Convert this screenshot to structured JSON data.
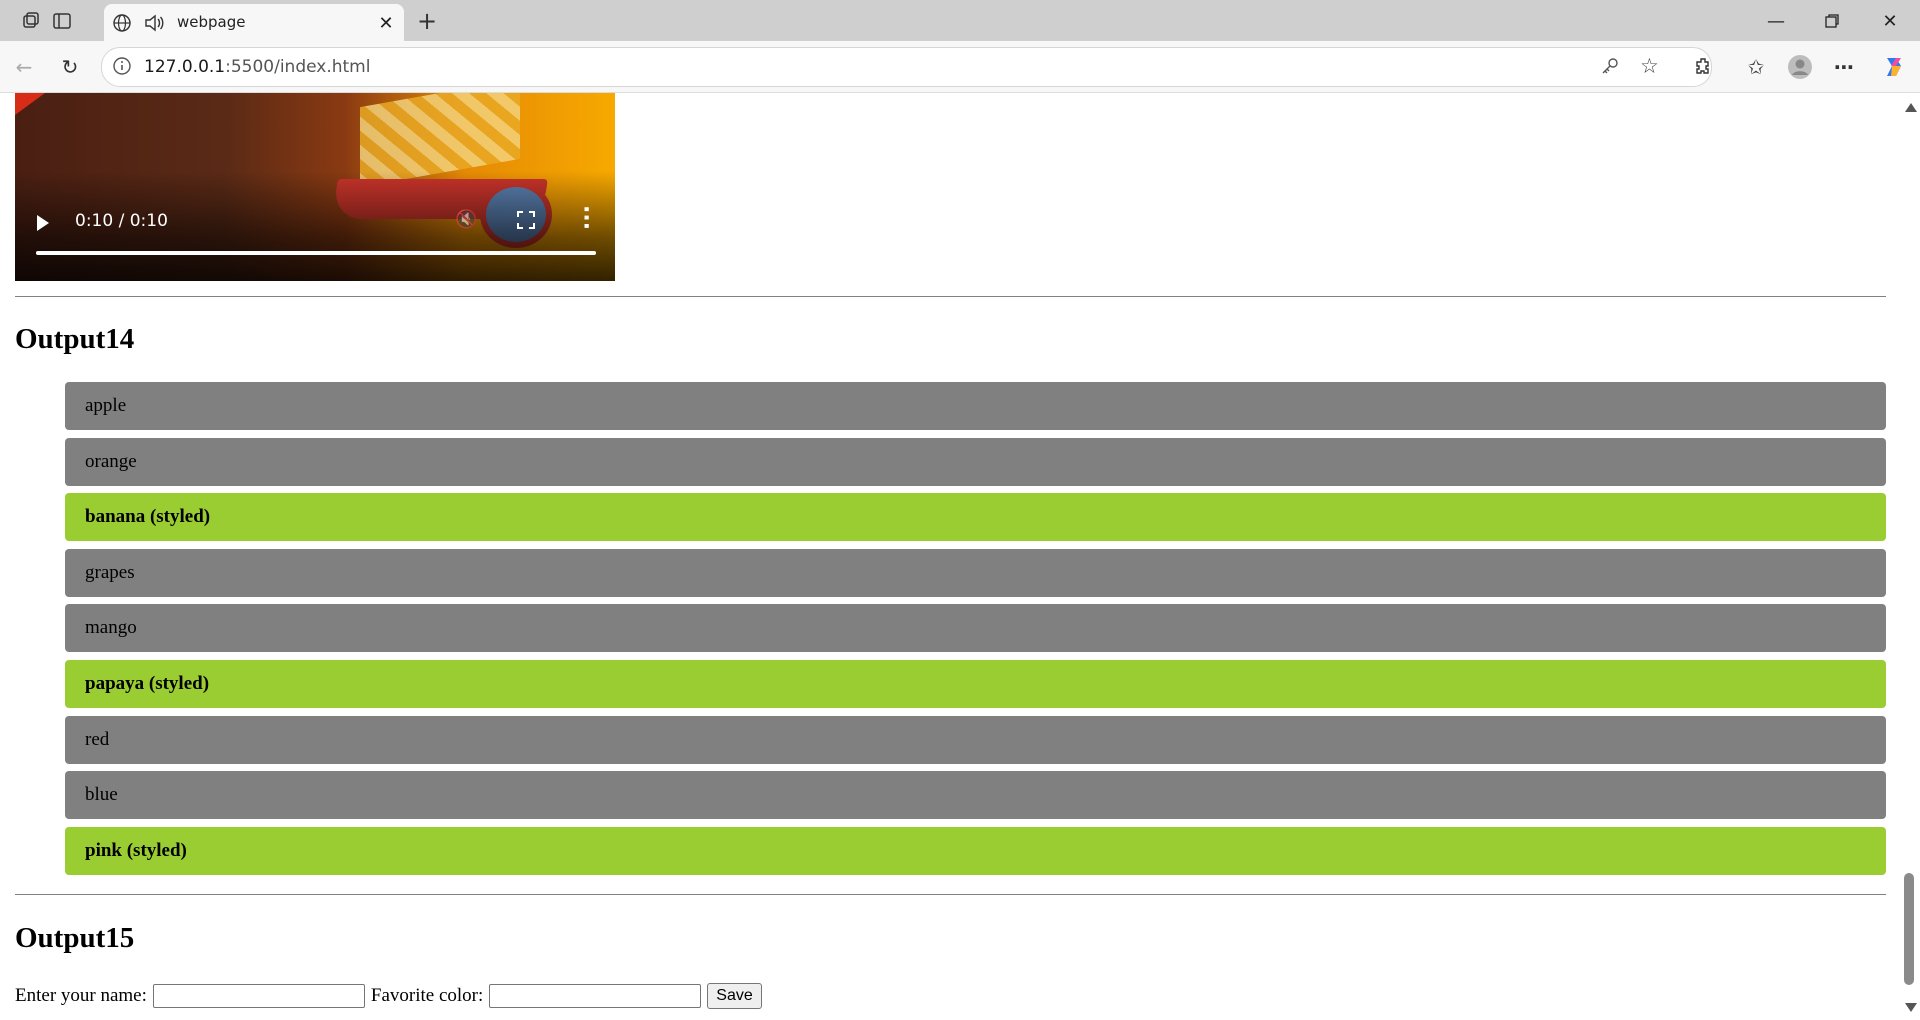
{
  "browser": {
    "tab_title": "webpage",
    "url_host": "127.0.0.1",
    "url_rest": ":5500/index.html"
  },
  "video": {
    "time": "0:10 / 0:10",
    "progress_fraction": 1.0
  },
  "output14": {
    "heading": "Output14",
    "items": [
      {
        "label": "apple",
        "styled": false
      },
      {
        "label": "orange",
        "styled": false
      },
      {
        "label": "banana (styled)",
        "styled": true
      },
      {
        "label": "grapes",
        "styled": false
      },
      {
        "label": "mango",
        "styled": false
      },
      {
        "label": "papaya (styled)",
        "styled": true
      },
      {
        "label": "red",
        "styled": false
      },
      {
        "label": "blue",
        "styled": false
      },
      {
        "label": "pink (styled)",
        "styled": true
      }
    ],
    "colors": {
      "default": "#808080",
      "styled": "#9acd32"
    }
  },
  "output15": {
    "heading": "Output15",
    "name_label": "Enter your name:",
    "name_value": "",
    "color_label": "Favorite color:",
    "color_value": "",
    "save_label": "Save"
  }
}
